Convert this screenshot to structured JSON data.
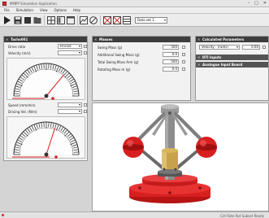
{
  "window": {
    "title": "MMPP Simulation Application",
    "controls": [
      "–",
      "□",
      "✕"
    ]
  },
  "menu": {
    "items": [
      "File",
      "Simulation",
      "View",
      "Options",
      "Help"
    ]
  },
  "toolbar": {
    "combo_value": "Data set 1"
  },
  "accent": {
    "red": "#d81f1f",
    "dark": "#3d3d3d",
    "gray_steel": "#8c8c8c",
    "brass": "#c8a24a"
  },
  "left_panel": {
    "title": "Tacho001",
    "rows": [
      {
        "label": "Drive ratio",
        "value": "Pinned"
      },
      {
        "label": "Velocity (m/s)"
      },
      {
        "label": "Speed (mm/min)"
      },
      {
        "label": "Driving Vel. (N/m)"
      }
    ],
    "gauge1_value": 0.72,
    "gauge2_value": 0.6
  },
  "middle_panel": {
    "title": "Masses",
    "rows": [
      {
        "label": "Swing Mass (g)",
        "value": "500"
      },
      {
        "label": "Additional Swing Mass (g)",
        "value": "0.0"
      },
      {
        "label": "Total Swing Mass Arm (g)",
        "value": "500"
      },
      {
        "label": "Rotating Mass m (g)",
        "value": "0.0"
      }
    ]
  },
  "right_panel": {
    "title": "Calculated Parameters",
    "dropdown_value": "Velocity - (rad/s)",
    "dropdown_value2": "0.00",
    "section2": "DTI Inputs",
    "section3": "Analogue Input Board"
  },
  "status": {
    "text": "Cnt Rate Rot Subset Ready"
  }
}
